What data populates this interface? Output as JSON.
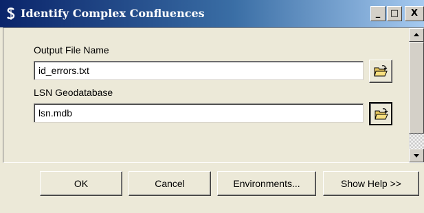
{
  "window": {
    "title": "Identify Complex Confluences",
    "icon": "script-tool-icon",
    "controls": {
      "minimize": "_",
      "maximize": "□",
      "close": "X"
    }
  },
  "form": {
    "output_file": {
      "label": "Output File Name",
      "value": "id_errors.txt",
      "browse_icon": "open-folder-icon"
    },
    "lsn_geodatabase": {
      "label": "LSN Geodatabase",
      "value": "lsn.mdb",
      "browse_icon": "open-folder-icon"
    }
  },
  "buttons": {
    "ok": "OK",
    "cancel": "Cancel",
    "environments": "Environments...",
    "show_help": "Show Help >>"
  },
  "colors": {
    "title_bar_start": "#0a246a",
    "title_bar_end": "#a6caf0",
    "dialog_background": "#ece9d8"
  }
}
